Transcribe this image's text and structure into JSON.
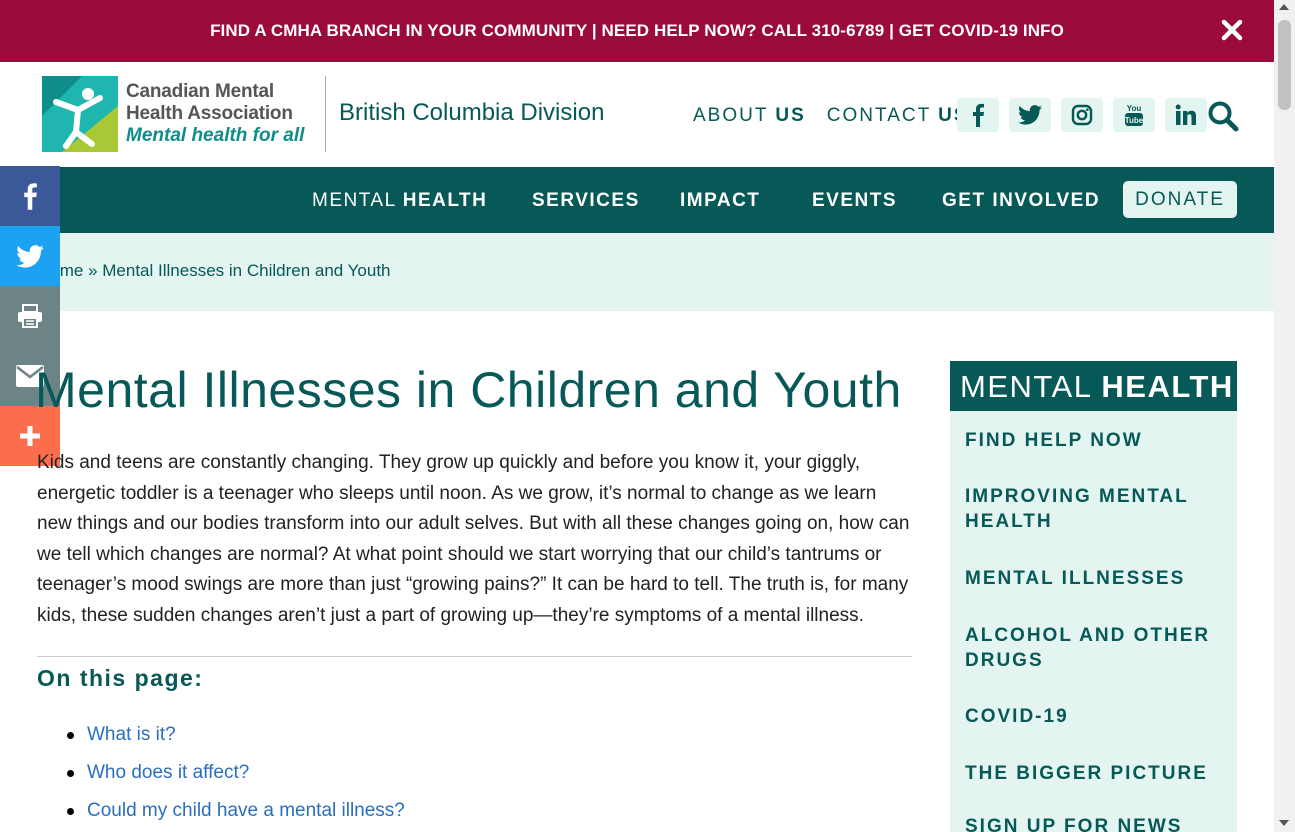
{
  "alert": {
    "text": "FIND A CMHA BRANCH IN YOUR COMMUNITY | NEED HELP NOW? CALL 310-6789 | GET COVID-19 INFO"
  },
  "logo": {
    "line1": "Canadian Mental",
    "line2": "Health Association",
    "tagline": "Mental health for all"
  },
  "division": "British Columbia Division",
  "utility_nav": {
    "about_a": "ABOUT ",
    "about_b": "US",
    "contact_a": "CONTACT ",
    "contact_b": "US"
  },
  "social_icons": [
    "facebook-icon",
    "twitter-icon",
    "instagram-icon",
    "youtube-icon",
    "linkedin-icon"
  ],
  "main_nav": {
    "mental_a": "MENTAL ",
    "mental_b": "HEALTH",
    "services": "SERVICES",
    "impact": "IMPACT",
    "events": "EVENTS",
    "getinvolved_a": "GET ",
    "getinvolved_b": "INVOLVED",
    "donate": "DONATE"
  },
  "breadcrumb": {
    "home": "Home",
    "separator": " » ",
    "current": "Mental Illnesses in Children and Youth"
  },
  "share_bar": [
    "facebook-icon",
    "twitter-icon",
    "print-icon",
    "email-icon",
    "plus-icon"
  ],
  "colors": {
    "alert_bg": "#9b0b3a",
    "brand_teal": "#065956",
    "light_teal": "#e3f4f1",
    "link_blue": "#2a6fbf"
  },
  "content": {
    "title": "Mental Illnesses in Children and Youth",
    "intro": "Kids and teens are constantly changing. They grow up quickly and before you know it, your giggly, energetic toddler is a teenager who sleeps until noon. As we grow, it’s normal to change as we learn new things and our bodies transform into our adult selves. But with all these changes going on, how can we tell which changes are normal? At what point should we start worrying that our child’s tantrums or teenager’s mood swings are more than just “growing pains?” It can be hard to tell. The truth is, for many kids, these sudden changes aren’t just a part of growing up—they’re symptoms of a mental illness.",
    "on_this_page": "On this page:",
    "toc": [
      "What is it?",
      "Who does it affect?",
      "Could my child have a mental illness?"
    ]
  },
  "sidebar": {
    "head_a": "MENTAL ",
    "head_b": "HEALTH",
    "items": [
      "FIND HELP NOW",
      "IMPROVING MENTAL HEALTH",
      "MENTAL ILLNESSES",
      "ALCOHOL AND OTHER DRUGS",
      "COVID-19",
      "THE BIGGER PICTURE",
      "SIGN UP FOR NEWS"
    ]
  }
}
